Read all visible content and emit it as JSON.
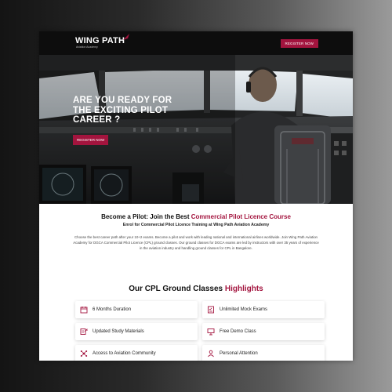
{
  "brand": {
    "logo_main": "WING PATH",
    "logo_sub": "Aviation Academy",
    "accent_color": "#a3143e"
  },
  "nav": {
    "register_label": "REGISTER NOW"
  },
  "hero": {
    "title_line1": "ARE YOU READY FOR",
    "title_line2": "THE EXCITING PILOT",
    "title_line3": "CAREER ?",
    "register_label": "REGISTER NOW"
  },
  "intro": {
    "heading_plain": "Become a Pilot: Join the Best ",
    "heading_accent": "Commercial Pilot Licence Course",
    "subheading": "Enrol for Commercial Pilot Licence Training at Wing Path Aviation Academy",
    "paragraph": "Choose the best career path after your 10+2 exams. Become a pilot and work with leading national and international airlines worldwide. Join Wing Path Aviation Academy for DGCA Commercial Pilot Licence (CPL) ground classes. Our ground classes for DGCA exams are led by instructors with over 35 years of experience in the aviation industry and handling ground classes for CPL in Bangalore."
  },
  "highlights": {
    "heading_plain": "Our CPL Ground Classes ",
    "heading_accent": "Highlights",
    "items": [
      {
        "label": "6 Months Duration",
        "icon": "calendar-icon"
      },
      {
        "label": "Unlimited Mock Exams",
        "icon": "checklist-icon"
      },
      {
        "label": "Updated Study Materials",
        "icon": "document-icon"
      },
      {
        "label": "Free Demo Class",
        "icon": "presentation-icon"
      },
      {
        "label": "Access to Aviation Community",
        "icon": "network-icon"
      },
      {
        "label": "Personal Attention",
        "icon": "person-icon"
      }
    ]
  }
}
